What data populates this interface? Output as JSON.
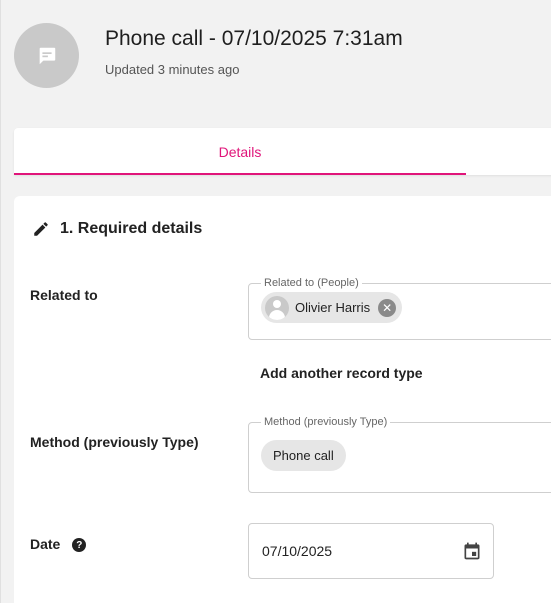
{
  "header": {
    "title": "Phone call - 07/10/2025 7:31am",
    "subtitle": "Updated 3 minutes ago",
    "avatar_icon": "message-icon"
  },
  "tabs": [
    {
      "label": "Details",
      "active": true
    }
  ],
  "section": {
    "title": "1. Required details",
    "icon": "pencil-icon"
  },
  "fields": {
    "related_to": {
      "label": "Related to",
      "legend": "Related to (People)",
      "chip": "Olivier Harris"
    },
    "add_record": "Add another record type",
    "method": {
      "label": "Method (previously Type)",
      "legend": "Method (previously Type)",
      "chip": "Phone call"
    },
    "date": {
      "label": "Date",
      "value": "07/10/2025",
      "help_icon": "help-icon",
      "calendar_icon": "calendar-icon"
    }
  },
  "colors": {
    "accent": "#e0157a",
    "background": "#f2f2f2",
    "card": "#ffffff"
  }
}
